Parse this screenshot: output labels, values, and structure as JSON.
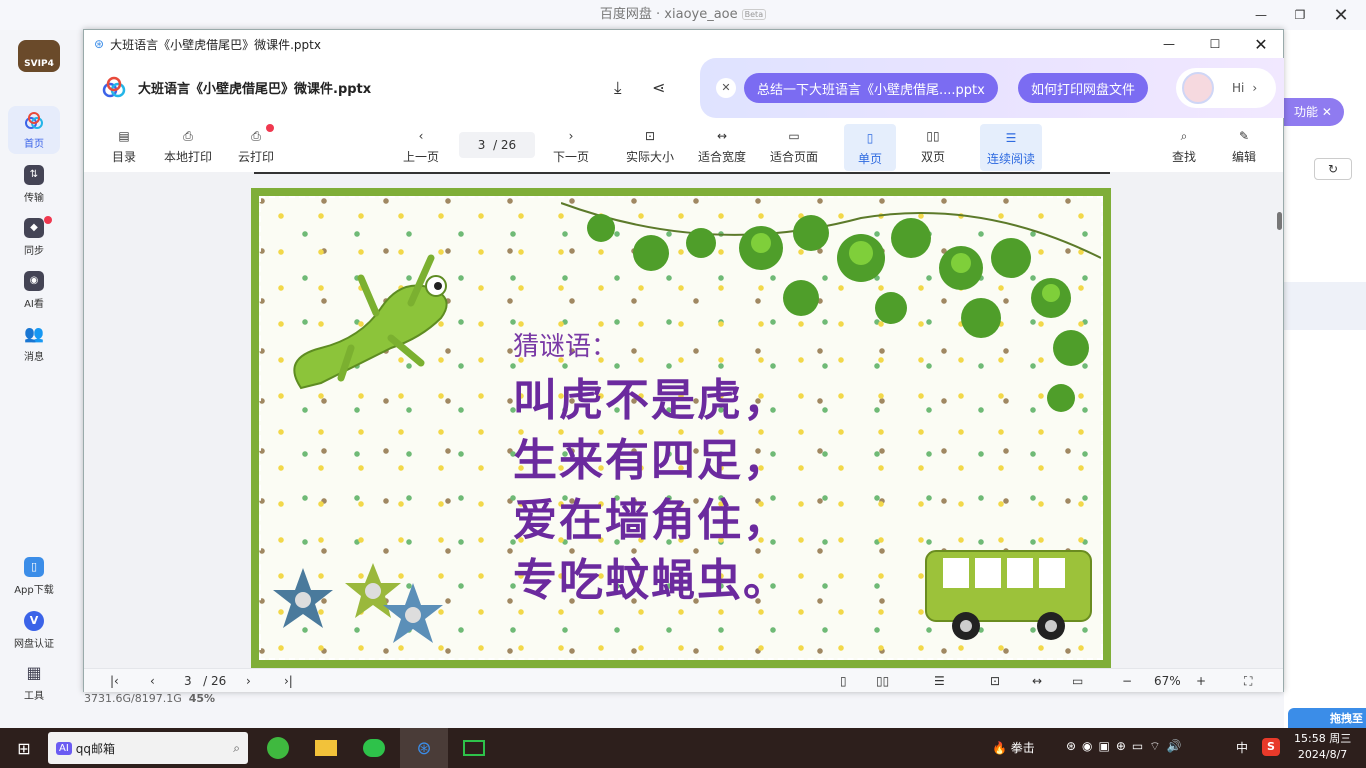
{
  "bg_window": {
    "title": "百度网盘 · xiaoye_aoe",
    "beta": "Beta",
    "stats": "3731.6G/8197.1G",
    "percent": "45%",
    "right_chip": "功能"
  },
  "left_nav": {
    "items": [
      {
        "label": "首页"
      },
      {
        "label": "传输"
      },
      {
        "label": "同步"
      },
      {
        "label": "AI看"
      },
      {
        "label": "消息"
      },
      {
        "label": "App下载"
      },
      {
        "label": "网盘认证"
      },
      {
        "label": "工具"
      }
    ]
  },
  "viewer": {
    "title": "大班语言《小壁虎借尾巴》微课件.pptx",
    "doc_name": "大班语言《小壁虎借尾巴》微课件.pptx"
  },
  "ai": {
    "chip1": "总结一下大班语言《小壁虎借尾....pptx",
    "chip2": "如何打印网盘文件",
    "hi": "Hi"
  },
  "toolbar": {
    "catalog": "目录",
    "local_print": "本地打印",
    "cloud_print": "云打印",
    "prev": "上一页",
    "page_current": "3",
    "page_total": "/ 26",
    "next": "下一页",
    "actual_size": "实际大小",
    "fit_width": "适合宽度",
    "fit_page": "适合页面",
    "single": "单页",
    "double": "双页",
    "continuous": "连续阅读",
    "find": "查找",
    "edit": "编辑"
  },
  "slide": {
    "heading": "猜谜语：",
    "lines": [
      "叫虎不是虎，",
      "生来有四足，",
      "爱在墙角住，",
      "专吃蚊蝇虫。"
    ]
  },
  "bottom_bar": {
    "page_current": "3",
    "page_total": "/ 26",
    "zoom": "67%"
  },
  "taskbar": {
    "search_text": "qq邮箱",
    "ai_label": "AI",
    "boxing": "拳击",
    "ime": "中",
    "time": "15:58 周三",
    "date": "2024/8/7",
    "drag_label": "拖拽至"
  }
}
